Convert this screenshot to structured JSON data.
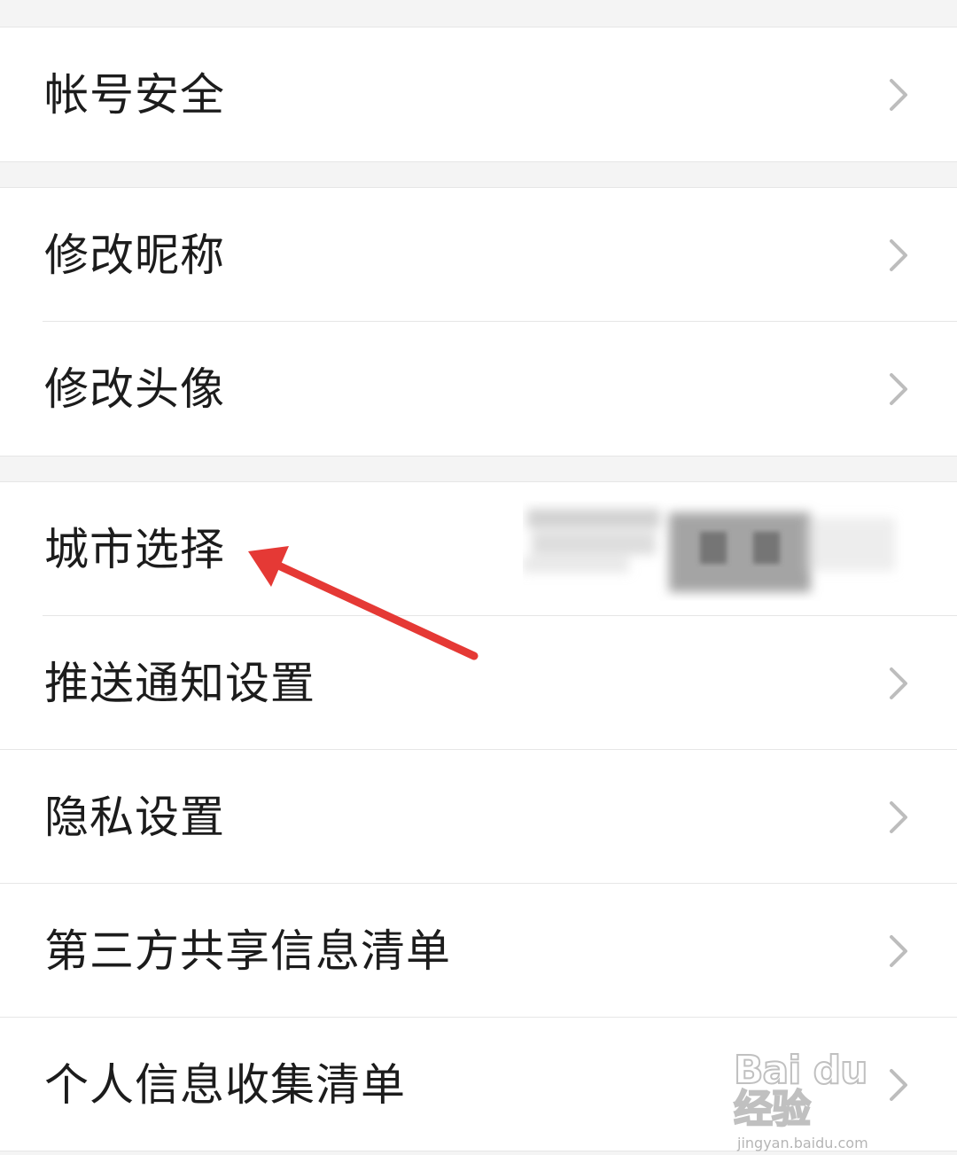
{
  "settings": {
    "items": [
      {
        "label": "帐号安全"
      },
      {
        "label": "修改昵称"
      },
      {
        "label": "修改头像"
      },
      {
        "label": "城市选择"
      },
      {
        "label": "推送通知设置"
      },
      {
        "label": "隐私设置"
      },
      {
        "label": "第三方共享信息清单"
      },
      {
        "label": "个人信息收集清单"
      }
    ]
  },
  "chevron_icon": "chevron-right-icon",
  "annotation": {
    "icon": "red-arrow-icon",
    "color": "#e53935"
  },
  "watermark": {
    "logo": "Bai du 经验",
    "url": "jingyan.baidu.com"
  },
  "colors": {
    "background": "#f4f4f4",
    "row": "#ffffff",
    "text": "#1c1c1c",
    "chevron": "#bdbdbd",
    "divider": "#e6e6e6"
  }
}
